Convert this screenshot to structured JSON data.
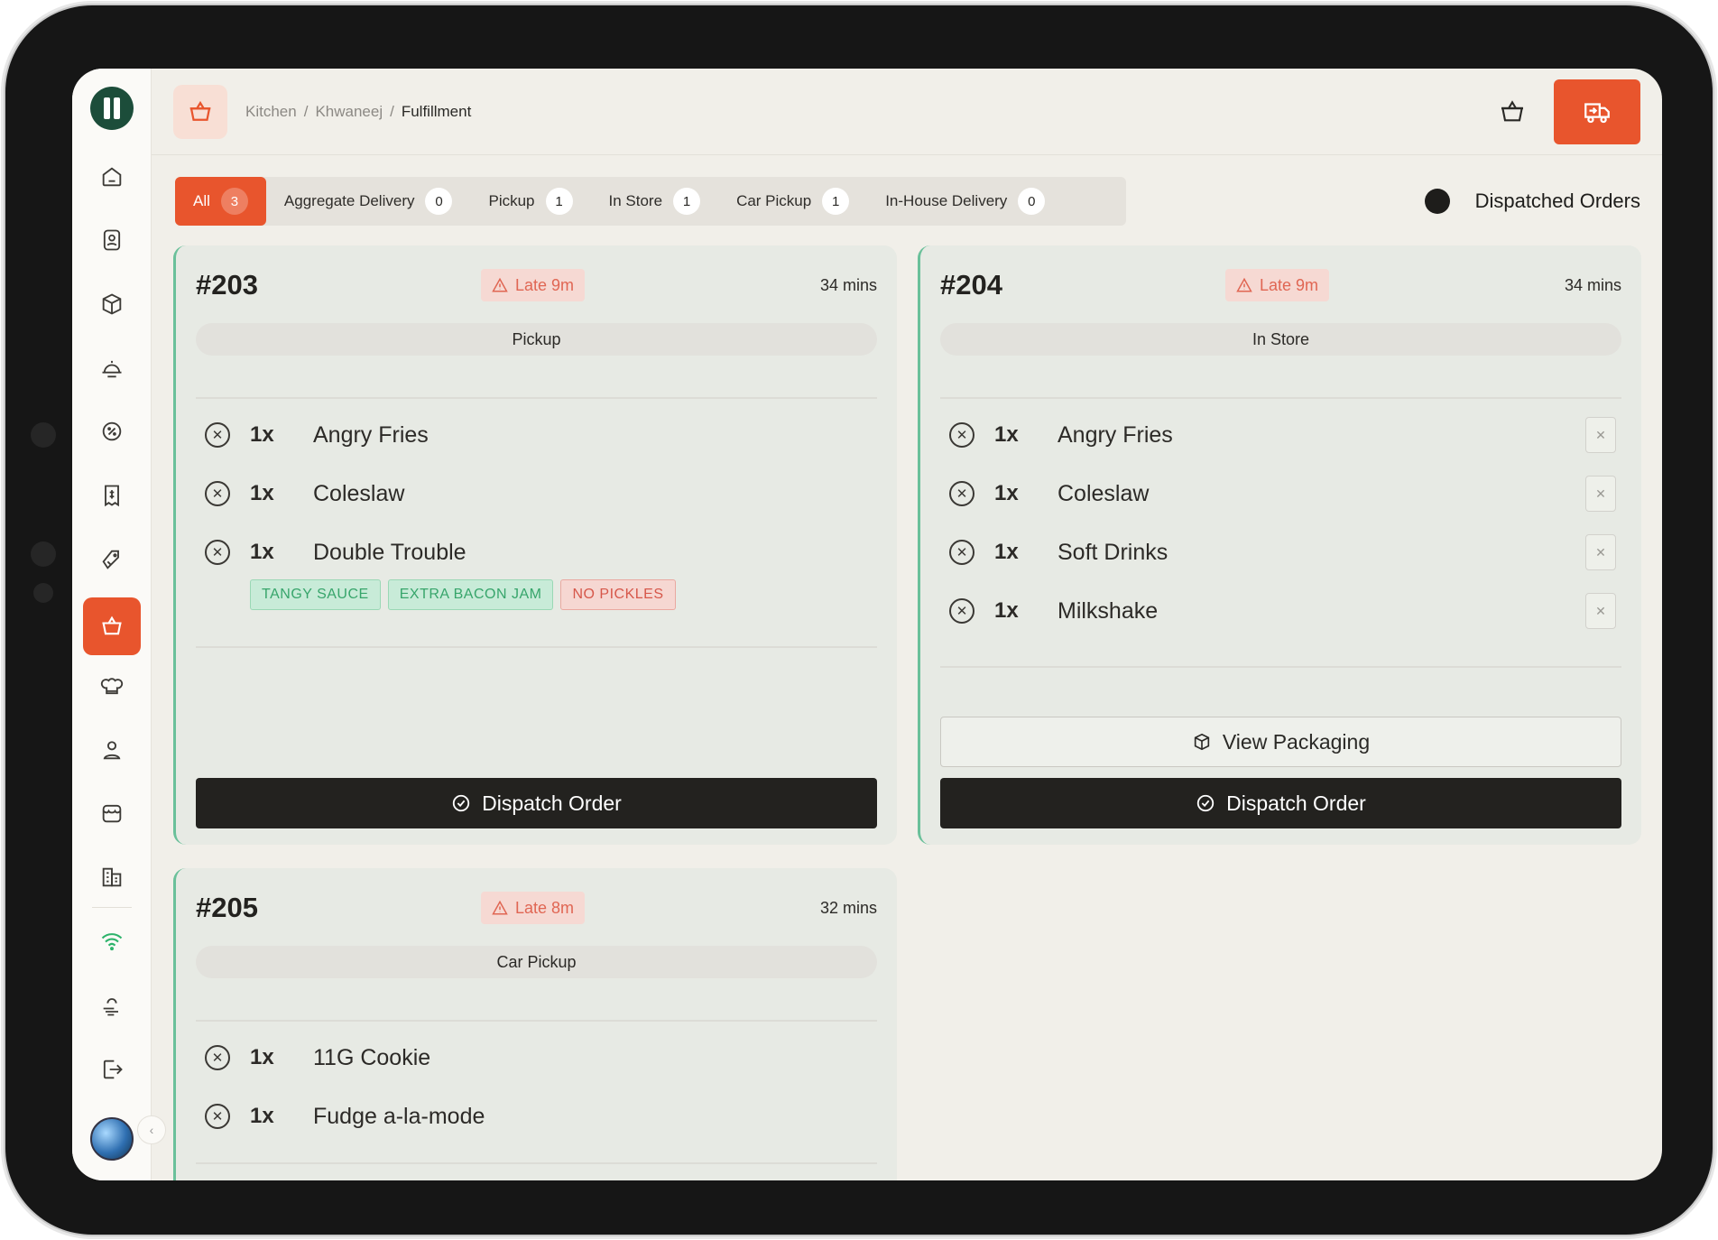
{
  "header": {
    "breadcrumb": [
      "Kitchen",
      "Khwaneej",
      "Fulfillment"
    ]
  },
  "tabs": [
    {
      "label": "All",
      "count": "3",
      "active": true
    },
    {
      "label": "Aggregate Delivery",
      "count": "0"
    },
    {
      "label": "Pickup",
      "count": "1"
    },
    {
      "label": "In Store",
      "count": "1"
    },
    {
      "label": "Car Pickup",
      "count": "1"
    },
    {
      "label": "In-House Delivery",
      "count": "0"
    }
  ],
  "dispatched_toggle": {
    "label": "Dispatched Orders",
    "on": false
  },
  "orders": [
    {
      "number": "#203",
      "late": "Late 9m",
      "mins": "34 mins",
      "type": "Pickup",
      "items": [
        {
          "qty": "1x",
          "name": "Angry Fries"
        },
        {
          "qty": "1x",
          "name": "Coleslaw"
        },
        {
          "qty": "1x",
          "name": "Double Trouble"
        }
      ],
      "modifiers": [
        {
          "label": "TANGY SAUCE",
          "kind": "add"
        },
        {
          "label": "EXTRA BACON JAM",
          "kind": "add"
        },
        {
          "label": "NO PICKLES",
          "kind": "remove"
        }
      ],
      "dispatch_label": "Dispatch Order"
    },
    {
      "number": "#204",
      "late": "Late 9m",
      "mins": "34 mins",
      "type": "In Store",
      "items": [
        {
          "qty": "1x",
          "name": "Angry Fries"
        },
        {
          "qty": "1x",
          "name": "Coleslaw"
        },
        {
          "qty": "1x",
          "name": "Soft Drinks"
        },
        {
          "qty": "1x",
          "name": "Milkshake"
        }
      ],
      "packaging_label": "View Packaging",
      "dispatch_label": "Dispatch Order"
    },
    {
      "number": "#205",
      "late": "Late 8m",
      "mins": "32 mins",
      "type": "Car Pickup",
      "items": [
        {
          "qty": "1x",
          "name": "11G Cookie"
        },
        {
          "qty": "1x",
          "name": "Fudge a-la-mode"
        }
      ]
    }
  ],
  "colors": {
    "accent": "#e8552d",
    "brand": "#1c4d3a",
    "card_border": "#6ac09a",
    "late": "#e06653",
    "dark": "#23221f"
  },
  "icons": {
    "sidebar": [
      "home-icon",
      "contact-book-icon",
      "box-icon",
      "dish-icon",
      "discount-icon",
      "receipt-icon",
      "tag-icon",
      "basket-icon",
      "chef-hat-icon",
      "user-icon",
      "store-icon",
      "buildings-icon",
      "wifi-icon",
      "weather-icon",
      "logout-icon"
    ]
  }
}
